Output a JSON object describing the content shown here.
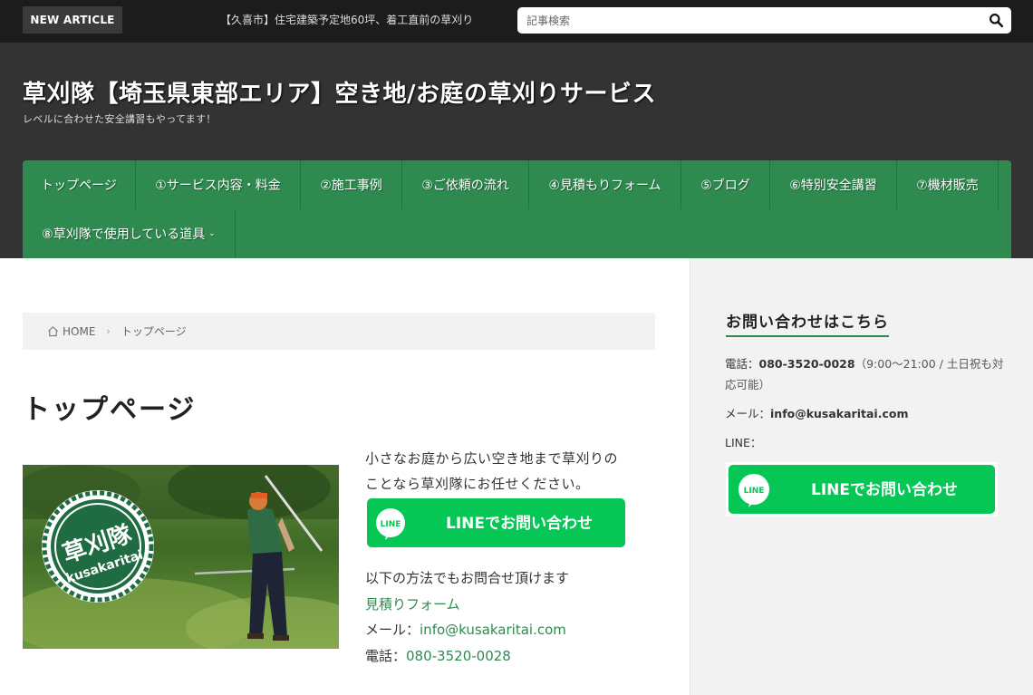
{
  "topbar": {
    "badge": "NEW ARTICLE",
    "ticker": "【久喜市】住宅建築予定地60坪、着工直前の草刈り",
    "search_placeholder": "記事検索"
  },
  "header": {
    "title": "草刈隊【埼玉県東部エリア】空き地/お庭の草刈りサービス",
    "tagline": "レベルに合わせた安全講習もやってます！"
  },
  "nav": {
    "items": [
      "トップページ",
      "①サービス内容・料金",
      "②施工事例",
      "③ご依頼の流れ",
      "④見積もりフォーム",
      "⑤ブログ",
      "⑥特別安全講習",
      "⑦機材販売",
      "⑧草刈隊で使用している道具"
    ]
  },
  "breadcrumb": {
    "home": "HOME",
    "current": "トップページ"
  },
  "main": {
    "page_title": "トップページ",
    "intro_1": "小さなお庭から広い空き地まで草刈りの",
    "intro_2": "ことなら草刈隊にお任せください。",
    "line_button": "LINEでお問い合わせ",
    "line_logo": "LINE",
    "hero_logo_main": "草刈隊",
    "hero_logo_sub": "kusakaritai",
    "methods_intro": "以下の方法でもお問合せ頂けます",
    "estimate_link": "見積りフォーム",
    "mail_label": "メール：",
    "mail": "info@kusakaritai.com",
    "phone_label": "電話：",
    "phone": "080-3520-0028"
  },
  "sidebar": {
    "title": "お問い合わせはこちら",
    "phone_label": "電話：",
    "phone": "080-3520-0028",
    "phone_hours": "（9:00～21:00 / 土日祝も対応可能）",
    "mail_label": "メール：",
    "mail": "info@kusakaritai.com",
    "line_label": "LINE：",
    "line_button": "LINEでお問い合わせ",
    "line_logo": "LINE"
  },
  "colors": {
    "accent": "#2f8a50",
    "line_green": "#06c755"
  }
}
